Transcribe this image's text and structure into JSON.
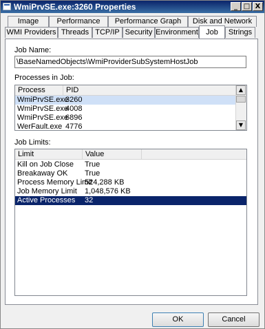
{
  "window": {
    "title": "WmiPrvSE.exe:3260 Properties",
    "controls": {
      "minimize": "_",
      "maximize": "□",
      "close": "X"
    }
  },
  "tabs_row1": [
    "Image",
    "Performance",
    "Performance Graph",
    "Disk and Network"
  ],
  "tabs_row2": [
    "WMI Providers",
    "Threads",
    "TCP/IP",
    "Security",
    "Environment",
    "Job",
    "Strings"
  ],
  "active_tab": "Job",
  "job": {
    "name_label": "Job Name:",
    "name_value": "\\BaseNamedObjects\\WmiProviderSubSystemHostJob",
    "processes_label": "Processes in Job:",
    "processes_columns": [
      "Process",
      "PID"
    ],
    "processes": [
      {
        "process": "WmiPrvSE.exe",
        "pid": "3260"
      },
      {
        "process": "WmiPrvSE.exe",
        "pid": "4008"
      },
      {
        "process": "WmiPrvSE.exe",
        "pid": "6896"
      },
      {
        "process": "WerFault.exe",
        "pid": "4776"
      }
    ],
    "limits_label": "Job Limits:",
    "limits_columns": [
      "Limit",
      "Value"
    ],
    "limits": [
      {
        "limit": "Kill on Job Close",
        "value": "True"
      },
      {
        "limit": "Breakaway OK",
        "value": "True"
      },
      {
        "limit": "Process Memory Limit",
        "value": "524,288 KB"
      },
      {
        "limit": "Job Memory Limit",
        "value": "1,048,576 KB"
      },
      {
        "limit": "Active Processes",
        "value": "32"
      }
    ]
  },
  "buttons": {
    "ok": "OK",
    "cancel": "Cancel"
  }
}
